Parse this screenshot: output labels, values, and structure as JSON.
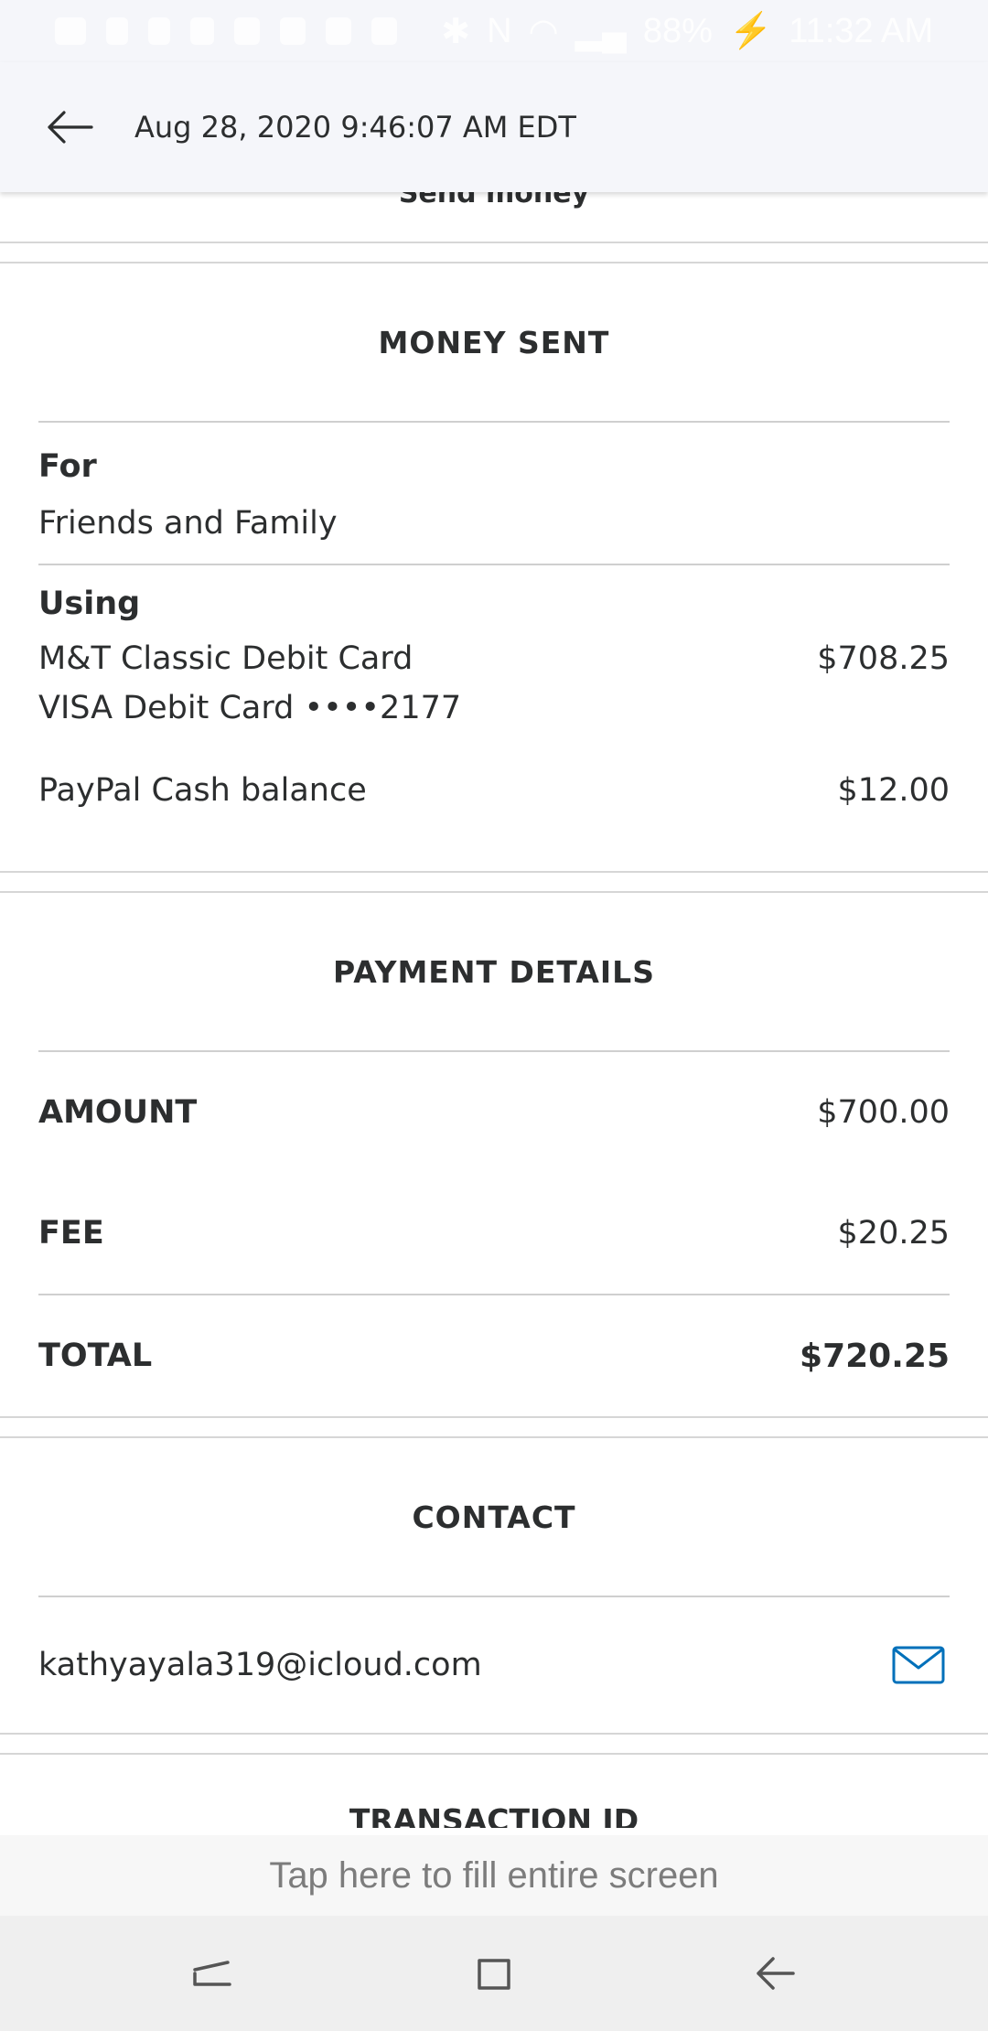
{
  "status_bar": {
    "battery": "88%",
    "time": "11:32 AM"
  },
  "header": {
    "title": "Aug 28, 2020 9:46:07 AM EDT"
  },
  "partial_top": {
    "text": "Send money"
  },
  "money_sent": {
    "title": "MONEY SENT",
    "for_label": "For",
    "for_value": "Friends and Family",
    "using_label": "Using",
    "card_name": "M&T Classic Debit Card",
    "card_detail": "VISA Debit Card ••••2177",
    "card_amount": "$708.25",
    "cash_label": "PayPal Cash balance",
    "cash_amount": "$12.00"
  },
  "payment_details": {
    "title": "PAYMENT DETAILS",
    "amount_label": "AMOUNT",
    "amount_value": "$700.00",
    "fee_label": "FEE",
    "fee_value": "$20.25",
    "total_label": "TOTAL",
    "total_value": "$720.25"
  },
  "contact": {
    "title": "CONTACT",
    "email": "kathyayala319@icloud.com",
    "icon": "mail-icon",
    "accent": "#0070ba"
  },
  "next_section": {
    "title": "TRANSACTION ID"
  },
  "fill_banner": {
    "text": "Tap here to fill entire screen"
  },
  "nav_bar": {
    "icons": [
      "recents-icon",
      "home-icon",
      "back-icon"
    ]
  }
}
